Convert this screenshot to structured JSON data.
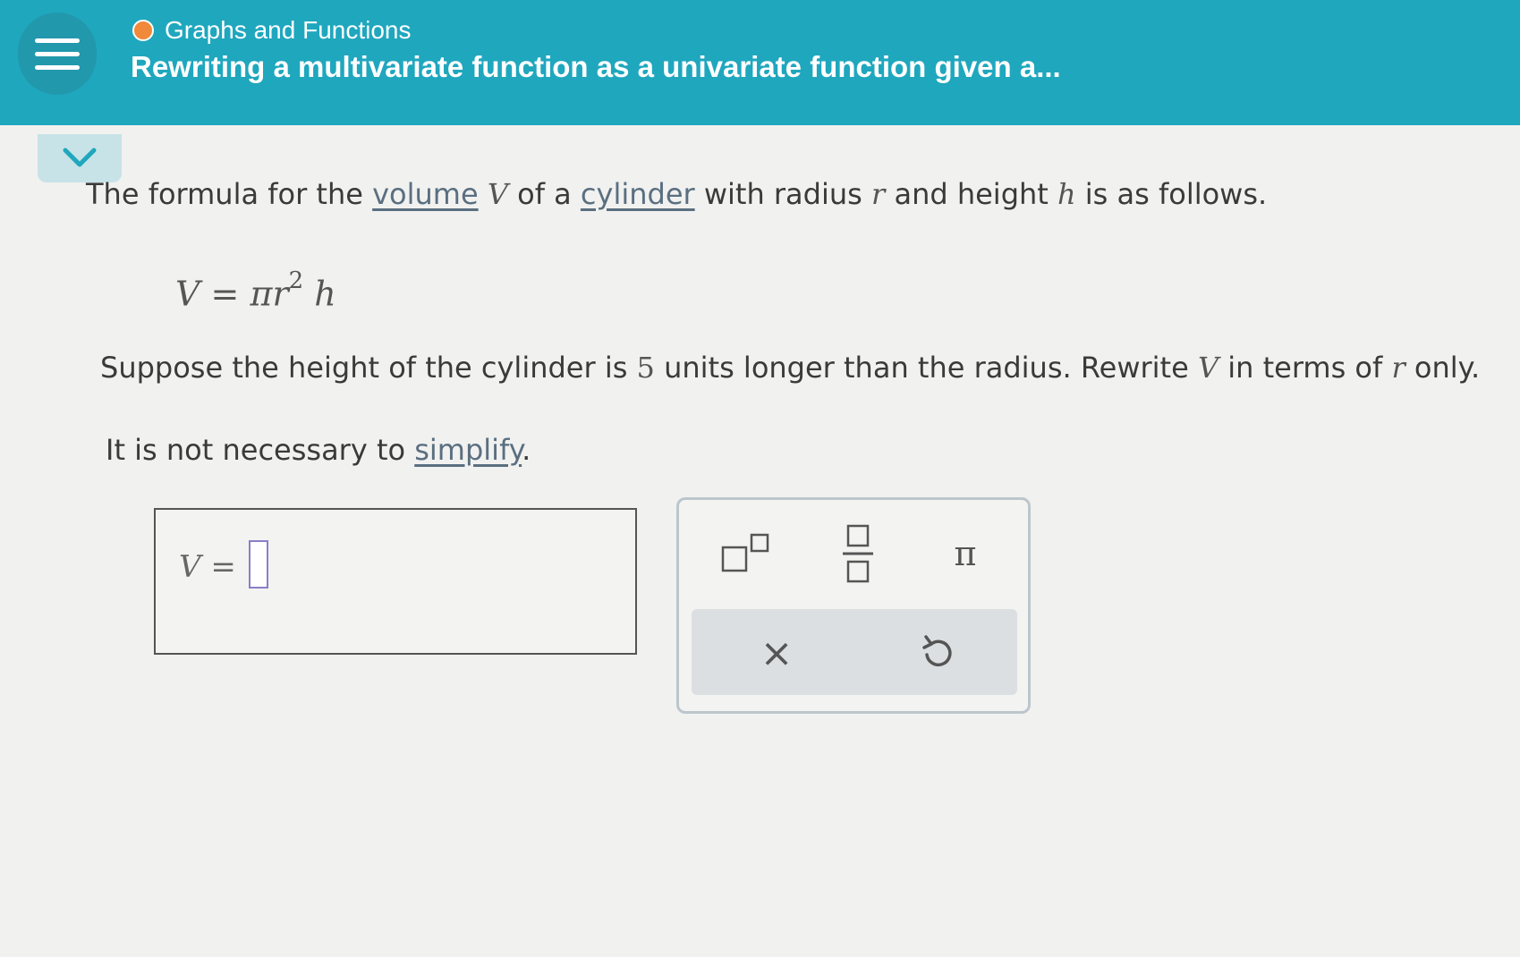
{
  "header": {
    "topic": "Graphs and Functions",
    "title": "Rewriting a multivariate function as a univariate function given a..."
  },
  "colors": {
    "header_bg": "#1fa7be",
    "topic_dot": "#f0893a",
    "content_bg": "#f1f1f0"
  },
  "problem": {
    "line1": {
      "t1": "The formula for the ",
      "link_volume": "volume",
      "t2": " ",
      "var_V": "V",
      "t3": " of a ",
      "link_cylinder": "cylinder",
      "t4": " with radius ",
      "var_r": "r",
      "t5": " and height ",
      "var_h": "h",
      "t6": " is as follows."
    },
    "formula": {
      "lhs": "V",
      "eq": "=",
      "pi_r": "πr",
      "exp": "2",
      "h": "h"
    },
    "line2": {
      "t1": "Suppose the height of the cylinder is ",
      "num": "5",
      "t2": " units longer than the radius. Rewrite ",
      "var_V": "V",
      "t3": " in terms of ",
      "var_r": "r",
      "t4": " only."
    },
    "line3": {
      "t1": "It is not necessary to ",
      "link_simplify": "simplify",
      "t2": "."
    }
  },
  "answer": {
    "lhs": "V",
    "eq": "=",
    "value": ""
  },
  "keypad": {
    "exponent_icon": "exponent-template-icon",
    "fraction_icon": "fraction-template-icon",
    "pi_label": "π",
    "clear_label": "×",
    "undo_icon": "undo-icon"
  }
}
